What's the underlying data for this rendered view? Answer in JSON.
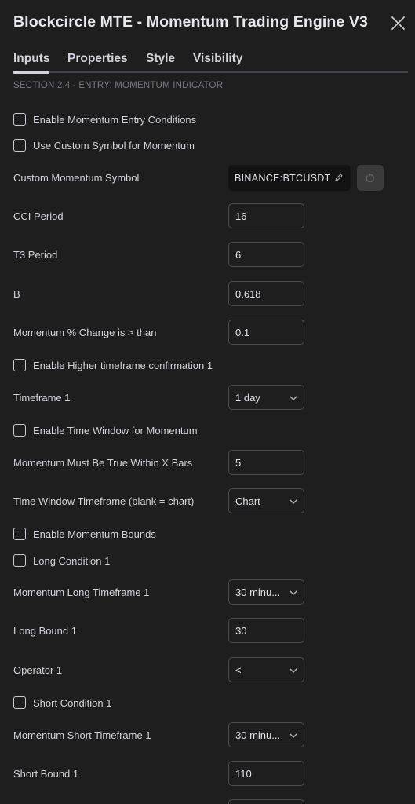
{
  "header": {
    "title": "Blockcircle MTE - Momentum Trading Engine V3"
  },
  "tabs": [
    {
      "label": "Inputs"
    },
    {
      "label": "Properties"
    },
    {
      "label": "Style"
    },
    {
      "label": "Visibility"
    }
  ],
  "section": {
    "title": "SECTION 2.4 - ENTRY: MOMENTUM INDICATOR"
  },
  "checkboxes": {
    "enable_momentum_entry": "Enable Momentum Entry Conditions",
    "use_custom_symbol": "Use Custom Symbol for Momentum",
    "enable_htf_confirmation": "Enable Higher timeframe confirmation 1",
    "enable_time_window": "Enable Time Window for Momentum",
    "enable_momentum_bounds": "Enable Momentum Bounds",
    "long_condition": "Long Condition 1",
    "short_condition": "Short Condition 1"
  },
  "fields": {
    "custom_symbol": {
      "label": "Custom Momentum Symbol",
      "value": "BINANCE:BTCUSDT"
    },
    "cci_period": {
      "label": "CCI Period",
      "value": "16"
    },
    "t3_period": {
      "label": "T3 Period",
      "value": "6"
    },
    "b": {
      "label": "B",
      "value": "0.618"
    },
    "momentum_change": {
      "label": "Momentum % Change is > than",
      "value": "0.1"
    },
    "timeframe1": {
      "label": "Timeframe 1",
      "value": "1 day"
    },
    "within_x_bars": {
      "label": "Momentum Must Be True Within X Bars",
      "value": "5"
    },
    "time_window_tf": {
      "label": "Time Window Timeframe (blank = chart)",
      "value": "Chart"
    },
    "long_tf": {
      "label": "Momentum Long Timeframe 1",
      "value": "30 minu..."
    },
    "long_bound": {
      "label": "Long Bound 1",
      "value": "30"
    },
    "operator": {
      "label": "Operator 1",
      "value": "<"
    },
    "short_tf": {
      "label": "Momentum Short Timeframe 1",
      "value": "30 minu..."
    },
    "short_bound": {
      "label": "Short Bound 1",
      "value": "110"
    }
  },
  "icons": {
    "close": "close-icon",
    "edit": "pencil-icon",
    "reset": "reset-icon",
    "chevron": "chevron-down-icon"
  },
  "colors": {
    "background": "#1e1e1e",
    "text": "#d1d4dc",
    "muted": "#787b86",
    "border": "#4a4d57"
  }
}
